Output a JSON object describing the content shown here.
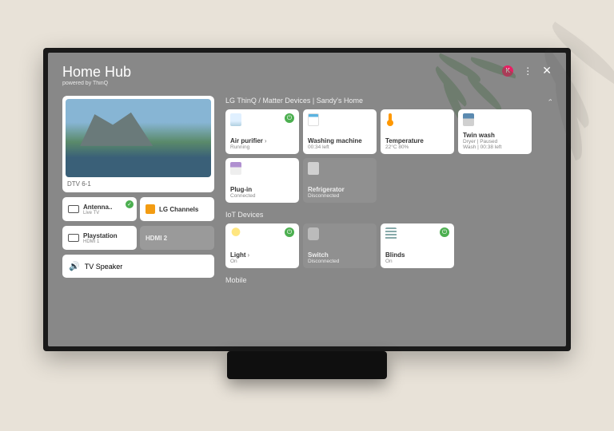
{
  "header": {
    "title": "Home Hub",
    "subtitle": "powered by ThinQ",
    "badge": "K"
  },
  "preview": {
    "label": "DTV 6-1"
  },
  "sources": {
    "antenna": {
      "name": "Antenna..",
      "sub": "Live TV"
    },
    "lgch": {
      "name": "LG Channels"
    },
    "ps": {
      "name": "Playstation",
      "sub": "HDMI 1"
    },
    "hdmi2": {
      "name": "HDMI 2"
    }
  },
  "speaker": {
    "name": "TV Speaker"
  },
  "sections": {
    "thinq": "LG ThinQ / Matter Devices | Sandy's Home",
    "iot": "IoT Devices",
    "mobile": "Mobile"
  },
  "devices": {
    "air": {
      "name": "Air purifier",
      "status": "Running"
    },
    "wash": {
      "name": "Washing machine",
      "status": "00:34 left"
    },
    "temp": {
      "name": "Temperature",
      "status": "22°C 80%"
    },
    "twin": {
      "name": "Twin wash",
      "status1": "Dryer | Paused",
      "status2": "Wash | 00:38 left"
    },
    "plug": {
      "name": "Plug-in",
      "status": "Connected"
    },
    "fridge": {
      "name": "Refrigerator",
      "status": "Disconnected"
    },
    "light": {
      "name": "Light",
      "status": "On"
    },
    "switch": {
      "name": "Switch",
      "status": "Disconnected"
    },
    "blinds": {
      "name": "Blinds",
      "status": "On"
    }
  }
}
